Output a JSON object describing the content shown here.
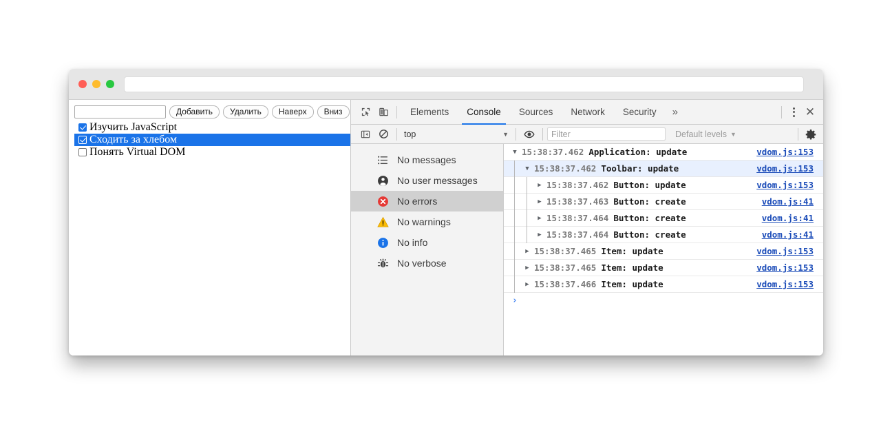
{
  "window": {
    "traffic_lights": [
      {
        "name": "close",
        "color": "#FF5F57"
      },
      {
        "name": "minimize",
        "color": "#FEBC2E"
      },
      {
        "name": "zoom",
        "color": "#28C840"
      }
    ],
    "url_value": "",
    "url_placeholder": ""
  },
  "page": {
    "todo_input_value": "",
    "todo_input_placeholder": "",
    "buttons": [
      {
        "label": "Добавить",
        "name": "add-todo-button"
      },
      {
        "label": "Удалить",
        "name": "delete-todo-button"
      },
      {
        "label": "Наверх",
        "name": "move-up-button"
      },
      {
        "label": "Вниз",
        "name": "move-down-button"
      }
    ],
    "items": [
      {
        "label": "Изучить JavaScript",
        "checked": true,
        "selected": false
      },
      {
        "label": "Сходить за хлебом",
        "checked": true,
        "selected": true
      },
      {
        "label": "Понять Virtual DOM",
        "checked": false,
        "selected": false
      }
    ]
  },
  "devtools": {
    "inspect_icon": "inspect-element-icon",
    "device_icon": "device-toolbar-icon",
    "tabs": [
      {
        "label": "Elements",
        "active": false
      },
      {
        "label": "Console",
        "active": true
      },
      {
        "label": "Sources",
        "active": false
      },
      {
        "label": "Network",
        "active": false
      },
      {
        "label": "Security",
        "active": false
      }
    ],
    "more_tabs_label": "»",
    "close_label": "✕",
    "accent_color": "#1a73e8",
    "toolbar": {
      "sidebar_toggle_icon": "show-console-sidebar-icon",
      "clear_icon": "clear-console-icon",
      "context_label": "top",
      "context_caret": "▼",
      "eye_icon": "live-expression-icon",
      "filter_value": "",
      "filter_placeholder": "Filter",
      "levels_label": "Default levels",
      "levels_caret": "▼",
      "settings_icon": "settings-gear-icon"
    },
    "sidebar": [
      {
        "label": "No messages",
        "icon": "list-icon",
        "selected": false
      },
      {
        "label": "No user messages",
        "icon": "user-icon",
        "selected": false
      },
      {
        "label": "No errors",
        "icon": "error-icon",
        "selected": true
      },
      {
        "label": "No warnings",
        "icon": "warning-icon",
        "selected": false
      },
      {
        "label": "No info",
        "icon": "info-icon",
        "selected": false
      },
      {
        "label": "No verbose",
        "icon": "verbose-bug-icon",
        "selected": false
      }
    ],
    "log": [
      {
        "time": "15:38:37.462",
        "message": "Application: update",
        "source": "vdom.js:153",
        "depth": 0,
        "expanded": true,
        "selected": false
      },
      {
        "time": "15:38:37.462",
        "message": "Toolbar: update",
        "source": "vdom.js:153",
        "depth": 1,
        "expanded": true,
        "selected": true
      },
      {
        "time": "15:38:37.462",
        "message": "Button: update",
        "source": "vdom.js:153",
        "depth": 2,
        "expanded": false,
        "selected": false
      },
      {
        "time": "15:38:37.463",
        "message": "Button: create",
        "source": "vdom.js:41",
        "depth": 2,
        "expanded": false,
        "selected": false
      },
      {
        "time": "15:38:37.464",
        "message": "Button: create",
        "source": "vdom.js:41",
        "depth": 2,
        "expanded": false,
        "selected": false
      },
      {
        "time": "15:38:37.464",
        "message": "Button: create",
        "source": "vdom.js:41",
        "depth": 2,
        "expanded": false,
        "selected": false
      },
      {
        "time": "15:38:37.465",
        "message": "Item: update",
        "source": "vdom.js:153",
        "depth": 1,
        "expanded": false,
        "selected": false
      },
      {
        "time": "15:38:37.465",
        "message": "Item: update",
        "source": "vdom.js:153",
        "depth": 1,
        "expanded": false,
        "selected": false
      },
      {
        "time": "15:38:37.466",
        "message": "Item: update",
        "source": "vdom.js:153",
        "depth": 1,
        "expanded": false,
        "selected": false
      }
    ],
    "prompt_symbol": "›"
  }
}
